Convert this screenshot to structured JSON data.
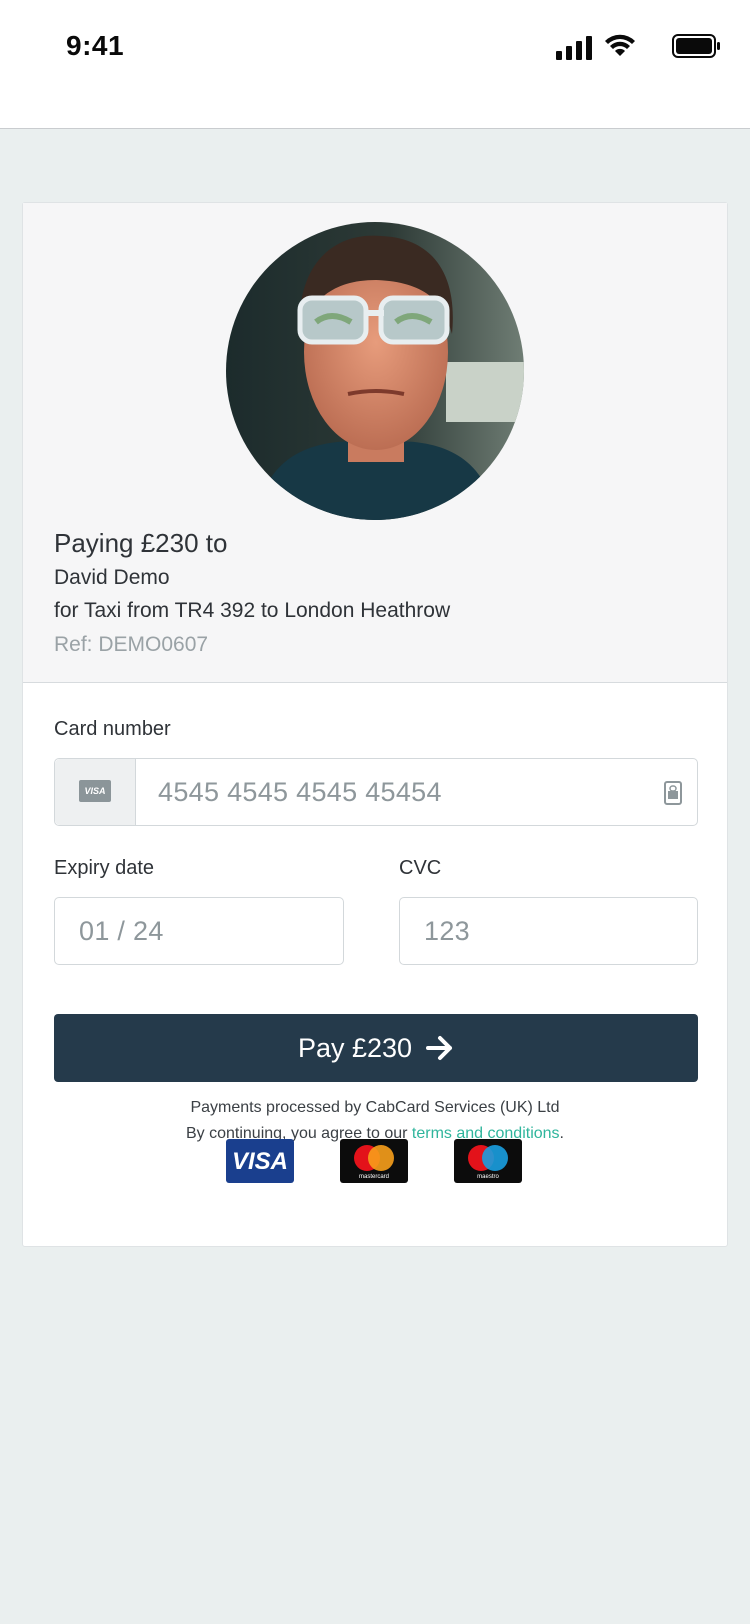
{
  "status_bar": {
    "time": "9:41",
    "icons": [
      "signal-icon",
      "wifi-icon",
      "battery-icon"
    ]
  },
  "payment": {
    "title": "Paying £230 to",
    "payee": "David Demo",
    "description": "for Taxi from TR4 392 to London Heathrow",
    "reference": "Ref: DEMO0607",
    "avatar": "driver-photo"
  },
  "form": {
    "card_number_label": "Card number",
    "card_number_placeholder": "4545 4545 4545 45454",
    "card_brand_icon_text": "VISA",
    "expiry_label": "Expiry date",
    "expiry_placeholder": "01 / 24",
    "cvc_label": "CVC",
    "cvc_placeholder": "123"
  },
  "pay_button": {
    "label": "Pay £230",
    "icon": "arrow-right-icon"
  },
  "legal": {
    "processor": "Payments processed by CabCard Services (UK) Ltd",
    "agree_prefix": "By continuing, you agree to our ",
    "terms_link": "terms and conditions",
    "agree_suffix": "."
  },
  "accepted_cards": {
    "visa": "VISA",
    "mastercard": "mastercard",
    "maestro": "maestro"
  },
  "colors": {
    "background": "#eaefef",
    "pay_button": "#253a4b",
    "link": "#2fb59c",
    "muted_text": "#9aa2a6"
  }
}
